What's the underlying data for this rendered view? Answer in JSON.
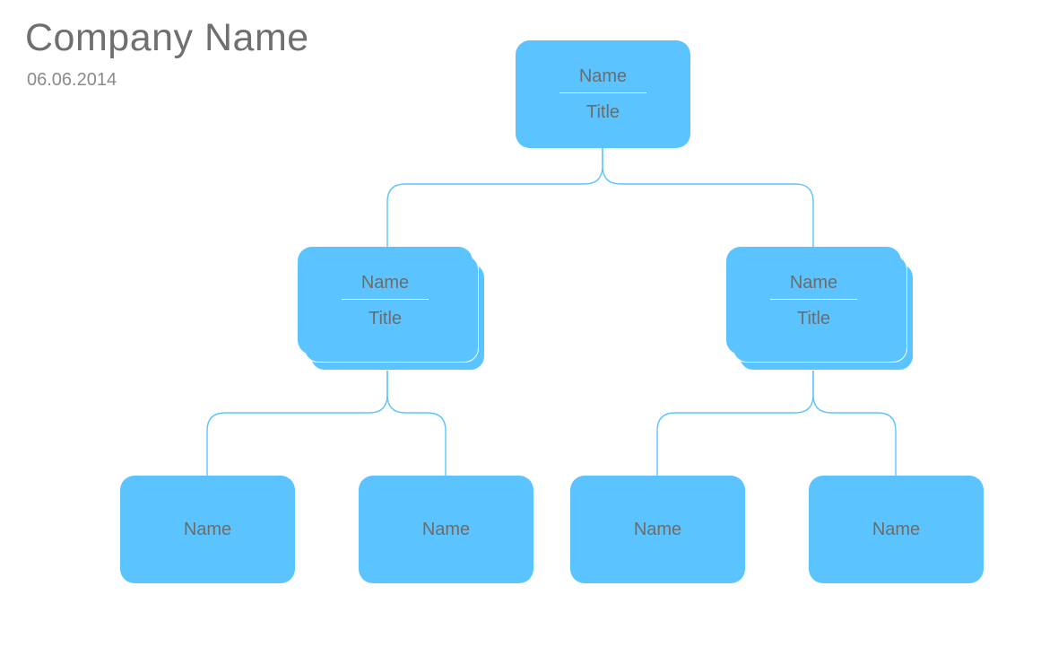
{
  "header": {
    "company_name": "Company Name",
    "date": "06.06.2014"
  },
  "colors": {
    "card_fill": "#5bc4ff",
    "text": "#6c6c6c",
    "connector": "#5bc4ff"
  },
  "org": {
    "root": {
      "name": "Name",
      "title": "Title"
    },
    "level2": [
      {
        "name": "Name",
        "title": "Title",
        "stacked": true
      },
      {
        "name": "Name",
        "title": "Title",
        "stacked": true
      }
    ],
    "level3": [
      {
        "name": "Name"
      },
      {
        "name": "Name"
      },
      {
        "name": "Name"
      },
      {
        "name": "Name"
      }
    ]
  }
}
